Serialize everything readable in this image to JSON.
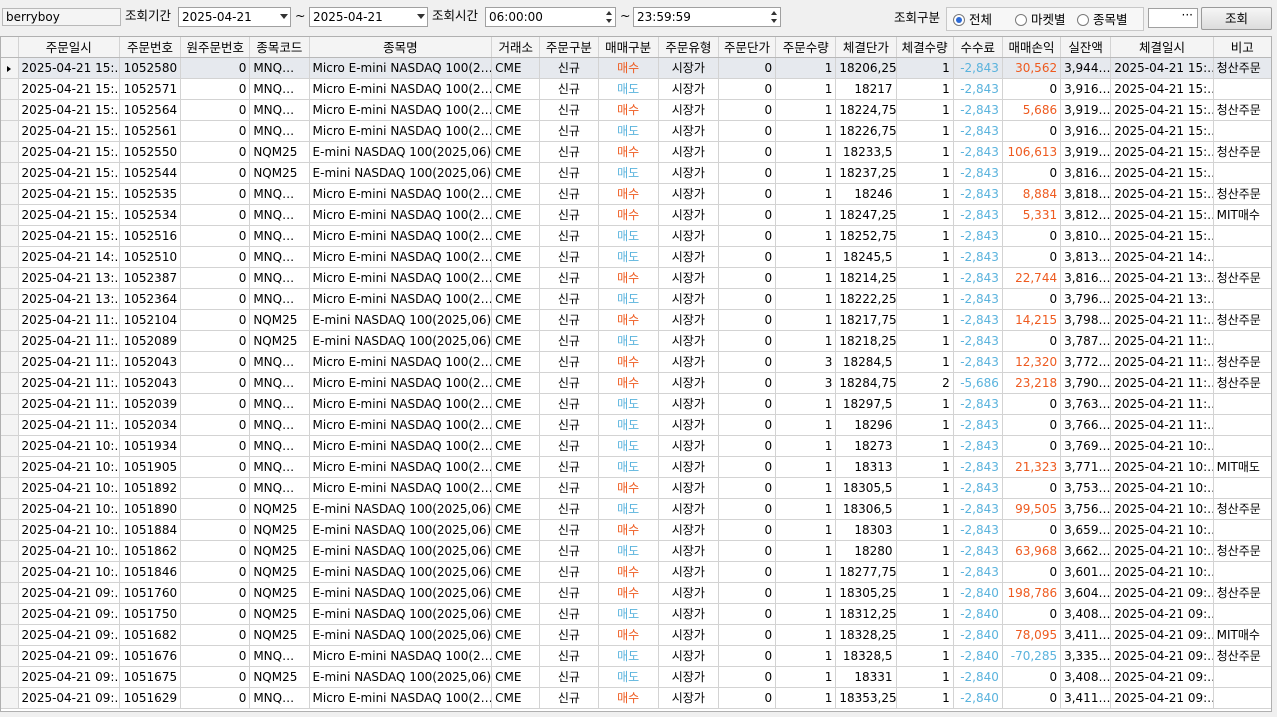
{
  "toolbar": {
    "user": "berryboy",
    "period_label": "조회기간",
    "date_from": "2025-04-21",
    "tilde1": "~",
    "date_to": "2025-04-21",
    "time_label": "조회시간",
    "time_from": "06:00:00",
    "tilde2": "~",
    "time_to": "23:59:59",
    "category_label": "조회구분",
    "radios": [
      {
        "label": "전체",
        "selected": true
      },
      {
        "label": "마켓별",
        "selected": false
      },
      {
        "label": "종목별",
        "selected": false
      }
    ],
    "extra_value": "···",
    "query_button": "조회"
  },
  "colors": {
    "buy": "#ee5a1f",
    "sell": "#5ab3dd",
    "fee": "#5ab3dd",
    "profit_positive": "#ee5a1f",
    "profit_negative": "#5ab3dd",
    "radio_selected": "#2d6ad6"
  },
  "table": {
    "columns": [
      "주문일시",
      "주문번호",
      "원주문번호",
      "종목코드",
      "종목명",
      "거래소",
      "주문구분",
      "매매구분",
      "주문유형",
      "주문단가",
      "주문수량",
      "체결단가",
      "체결수량",
      "수수료",
      "매매손익",
      "실잔액",
      "체결일시",
      "비고"
    ],
    "rows": [
      [
        "2025-04-21 15:…",
        "1052580",
        "0",
        "MNQ…",
        "Micro E-mini NASDAQ 100(2…",
        "CME",
        "신규",
        "매수",
        "시장가",
        "0",
        "1",
        "18206,25",
        "1",
        "-2,843",
        "30,562",
        "3,944…",
        "2025-04-21 15:…",
        "청산주문"
      ],
      [
        "2025-04-21 15:…",
        "1052571",
        "0",
        "MNQ…",
        "Micro E-mini NASDAQ 100(2…",
        "CME",
        "신규",
        "매도",
        "시장가",
        "0",
        "1",
        "18217",
        "1",
        "-2,843",
        "0",
        "3,916…",
        "2025-04-21 15:…",
        ""
      ],
      [
        "2025-04-21 15:…",
        "1052564",
        "0",
        "MNQ…",
        "Micro E-mini NASDAQ 100(2…",
        "CME",
        "신규",
        "매수",
        "시장가",
        "0",
        "1",
        "18224,75",
        "1",
        "-2,843",
        "5,686",
        "3,919…",
        "2025-04-21 15:…",
        "청산주문"
      ],
      [
        "2025-04-21 15:…",
        "1052561",
        "0",
        "MNQ…",
        "Micro E-mini NASDAQ 100(2…",
        "CME",
        "신규",
        "매도",
        "시장가",
        "0",
        "1",
        "18226,75",
        "1",
        "-2,843",
        "0",
        "3,916…",
        "2025-04-21 15:…",
        ""
      ],
      [
        "2025-04-21 15:…",
        "1052550",
        "0",
        "NQM25",
        "E-mini NASDAQ 100(2025,06)",
        "CME",
        "신규",
        "매수",
        "시장가",
        "0",
        "1",
        "18233,5",
        "1",
        "-2,843",
        "106,613",
        "3,919…",
        "2025-04-21 15:…",
        "청산주문"
      ],
      [
        "2025-04-21 15:…",
        "1052544",
        "0",
        "NQM25",
        "E-mini NASDAQ 100(2025,06)",
        "CME",
        "신규",
        "매도",
        "시장가",
        "0",
        "1",
        "18237,25",
        "1",
        "-2,843",
        "0",
        "3,816…",
        "2025-04-21 15:…",
        ""
      ],
      [
        "2025-04-21 15:…",
        "1052535",
        "0",
        "MNQ…",
        "Micro E-mini NASDAQ 100(2…",
        "CME",
        "신규",
        "매수",
        "시장가",
        "0",
        "1",
        "18246",
        "1",
        "-2,843",
        "8,884",
        "3,818…",
        "2025-04-21 15:…",
        "청산주문"
      ],
      [
        "2025-04-21 15:…",
        "1052534",
        "0",
        "MNQ…",
        "Micro E-mini NASDAQ 100(2…",
        "CME",
        "신규",
        "매수",
        "시장가",
        "0",
        "1",
        "18247,25",
        "1",
        "-2,843",
        "5,331",
        "3,812…",
        "2025-04-21 15:…",
        "MIT매수"
      ],
      [
        "2025-04-21 15:…",
        "1052516",
        "0",
        "MNQ…",
        "Micro E-mini NASDAQ 100(2…",
        "CME",
        "신규",
        "매도",
        "시장가",
        "0",
        "1",
        "18252,75",
        "1",
        "-2,843",
        "0",
        "3,810…",
        "2025-04-21 15:…",
        ""
      ],
      [
        "2025-04-21 14:…",
        "1052510",
        "0",
        "MNQ…",
        "Micro E-mini NASDAQ 100(2…",
        "CME",
        "신규",
        "매도",
        "시장가",
        "0",
        "1",
        "18245,5",
        "1",
        "-2,843",
        "0",
        "3,813…",
        "2025-04-21 14:…",
        ""
      ],
      [
        "2025-04-21 13:…",
        "1052387",
        "0",
        "MNQ…",
        "Micro E-mini NASDAQ 100(2…",
        "CME",
        "신규",
        "매수",
        "시장가",
        "0",
        "1",
        "18214,25",
        "1",
        "-2,843",
        "22,744",
        "3,816…",
        "2025-04-21 13:…",
        "청산주문"
      ],
      [
        "2025-04-21 13:…",
        "1052364",
        "0",
        "MNQ…",
        "Micro E-mini NASDAQ 100(2…",
        "CME",
        "신규",
        "매도",
        "시장가",
        "0",
        "1",
        "18222,25",
        "1",
        "-2,843",
        "0",
        "3,796…",
        "2025-04-21 13:…",
        ""
      ],
      [
        "2025-04-21 11:…",
        "1052104",
        "0",
        "NQM25",
        "E-mini NASDAQ 100(2025,06)",
        "CME",
        "신규",
        "매수",
        "시장가",
        "0",
        "1",
        "18217,75",
        "1",
        "-2,843",
        "14,215",
        "3,798…",
        "2025-04-21 11:…",
        "청산주문"
      ],
      [
        "2025-04-21 11:…",
        "1052089",
        "0",
        "NQM25",
        "E-mini NASDAQ 100(2025,06)",
        "CME",
        "신규",
        "매도",
        "시장가",
        "0",
        "1",
        "18218,25",
        "1",
        "-2,843",
        "0",
        "3,787…",
        "2025-04-21 11:…",
        ""
      ],
      [
        "2025-04-21 11:…",
        "1052043",
        "0",
        "MNQ…",
        "Micro E-mini NASDAQ 100(2…",
        "CME",
        "신규",
        "매수",
        "시장가",
        "0",
        "3",
        "18284,5",
        "1",
        "-2,843",
        "12,320",
        "3,772…",
        "2025-04-21 11:…",
        "청산주문"
      ],
      [
        "2025-04-21 11:…",
        "1052043",
        "0",
        "MNQ…",
        "Micro E-mini NASDAQ 100(2…",
        "CME",
        "신규",
        "매수",
        "시장가",
        "0",
        "3",
        "18284,75",
        "2",
        "-5,686",
        "23,218",
        "3,790…",
        "2025-04-21 11:…",
        "청산주문"
      ],
      [
        "2025-04-21 11:…",
        "1052039",
        "0",
        "MNQ…",
        "Micro E-mini NASDAQ 100(2…",
        "CME",
        "신규",
        "매도",
        "시장가",
        "0",
        "1",
        "18297,5",
        "1",
        "-2,843",
        "0",
        "3,763…",
        "2025-04-21 11:…",
        ""
      ],
      [
        "2025-04-21 11:…",
        "1052034",
        "0",
        "MNQ…",
        "Micro E-mini NASDAQ 100(2…",
        "CME",
        "신규",
        "매도",
        "시장가",
        "0",
        "1",
        "18296",
        "1",
        "-2,843",
        "0",
        "3,766…",
        "2025-04-21 11:…",
        ""
      ],
      [
        "2025-04-21 10:…",
        "1051934",
        "0",
        "MNQ…",
        "Micro E-mini NASDAQ 100(2…",
        "CME",
        "신규",
        "매도",
        "시장가",
        "0",
        "1",
        "18273",
        "1",
        "-2,843",
        "0",
        "3,769…",
        "2025-04-21 10:…",
        ""
      ],
      [
        "2025-04-21 10:…",
        "1051905",
        "0",
        "MNQ…",
        "Micro E-mini NASDAQ 100(2…",
        "CME",
        "신규",
        "매도",
        "시장가",
        "0",
        "1",
        "18313",
        "1",
        "-2,843",
        "21,323",
        "3,771…",
        "2025-04-21 10:…",
        "MIT매도"
      ],
      [
        "2025-04-21 10:…",
        "1051892",
        "0",
        "MNQ…",
        "Micro E-mini NASDAQ 100(2…",
        "CME",
        "신규",
        "매수",
        "시장가",
        "0",
        "1",
        "18305,5",
        "1",
        "-2,843",
        "0",
        "3,753…",
        "2025-04-21 10:…",
        ""
      ],
      [
        "2025-04-21 10:…",
        "1051890",
        "0",
        "NQM25",
        "E-mini NASDAQ 100(2025,06)",
        "CME",
        "신규",
        "매도",
        "시장가",
        "0",
        "1",
        "18306,5",
        "1",
        "-2,843",
        "99,505",
        "3,756…",
        "2025-04-21 10:…",
        "청산주문"
      ],
      [
        "2025-04-21 10:…",
        "1051884",
        "0",
        "NQM25",
        "E-mini NASDAQ 100(2025,06)",
        "CME",
        "신규",
        "매수",
        "시장가",
        "0",
        "1",
        "18303",
        "1",
        "-2,843",
        "0",
        "3,659…",
        "2025-04-21 10:…",
        ""
      ],
      [
        "2025-04-21 10:…",
        "1051862",
        "0",
        "NQM25",
        "E-mini NASDAQ 100(2025,06)",
        "CME",
        "신규",
        "매도",
        "시장가",
        "0",
        "1",
        "18280",
        "1",
        "-2,843",
        "63,968",
        "3,662…",
        "2025-04-21 10:…",
        "청산주문"
      ],
      [
        "2025-04-21 10:…",
        "1051846",
        "0",
        "NQM25",
        "E-mini NASDAQ 100(2025,06)",
        "CME",
        "신규",
        "매수",
        "시장가",
        "0",
        "1",
        "18277,75",
        "1",
        "-2,843",
        "0",
        "3,601…",
        "2025-04-21 10:…",
        ""
      ],
      [
        "2025-04-21 09:…",
        "1051760",
        "0",
        "NQM25",
        "E-mini NASDAQ 100(2025,06)",
        "CME",
        "신규",
        "매수",
        "시장가",
        "0",
        "1",
        "18305,25",
        "1",
        "-2,840",
        "198,786",
        "3,604…",
        "2025-04-21 09:…",
        "청산주문"
      ],
      [
        "2025-04-21 09:…",
        "1051750",
        "0",
        "NQM25",
        "E-mini NASDAQ 100(2025,06)",
        "CME",
        "신규",
        "매도",
        "시장가",
        "0",
        "1",
        "18312,25",
        "1",
        "-2,840",
        "0",
        "3,408…",
        "2025-04-21 09:…",
        ""
      ],
      [
        "2025-04-21 09:…",
        "1051682",
        "0",
        "NQM25",
        "E-mini NASDAQ 100(2025,06)",
        "CME",
        "신규",
        "매수",
        "시장가",
        "0",
        "1",
        "18328,25",
        "1",
        "-2,840",
        "78,095",
        "3,411…",
        "2025-04-21 09:…",
        "MIT매수"
      ],
      [
        "2025-04-21 09:…",
        "1051676",
        "0",
        "MNQ…",
        "Micro E-mini NASDAQ 100(2…",
        "CME",
        "신규",
        "매도",
        "시장가",
        "0",
        "1",
        "18328,5",
        "1",
        "-2,840",
        "-70,285",
        "3,335…",
        "2025-04-21 09:…",
        "청산주문"
      ],
      [
        "2025-04-21 09:…",
        "1051675",
        "0",
        "NQM25",
        "E-mini NASDAQ 100(2025,06)",
        "CME",
        "신규",
        "매도",
        "시장가",
        "0",
        "1",
        "18331",
        "1",
        "-2,840",
        "0",
        "3,408…",
        "2025-04-21 09:…",
        ""
      ],
      [
        "2025-04-21 09:…",
        "1051629",
        "0",
        "MNQ…",
        "Micro E-mini NASDAQ 100(2…",
        "CME",
        "신규",
        "매수",
        "시장가",
        "0",
        "1",
        "18353,25",
        "1",
        "-2,840",
        "0",
        "3,411…",
        "2025-04-21 09:…",
        ""
      ]
    ]
  }
}
